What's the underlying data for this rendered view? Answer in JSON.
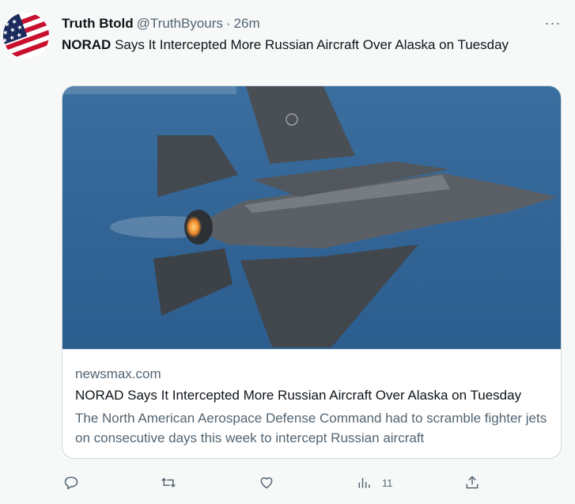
{
  "tweet": {
    "display_name": "Truth Btold",
    "handle": "@TruthByours",
    "separator": "·",
    "time": "26m",
    "more_icon": "···",
    "text_bold": "NORAD",
    "text_rest": " Says It Intercepted More Russian Aircraft Over Alaska on Tuesday"
  },
  "card": {
    "domain": "newsmax.com",
    "title": "NORAD Says It Intercepted More Russian Aircraft Over Alaska on Tuesday",
    "description": "The North American Aerospace Defense Command had to scramble fighter jets on consecutive days this week to intercept Russian aircraft"
  },
  "actions": {
    "reply_icon": "reply-icon",
    "retweet_icon": "retweet-icon",
    "like_icon": "heart-icon",
    "views_icon": "views-icon",
    "views_count": "11",
    "share_icon": "share-icon"
  },
  "colors": {
    "text_primary": "#0f1419",
    "text_secondary": "#536471",
    "border": "#cfd9de",
    "background": "#f7f9f9"
  }
}
